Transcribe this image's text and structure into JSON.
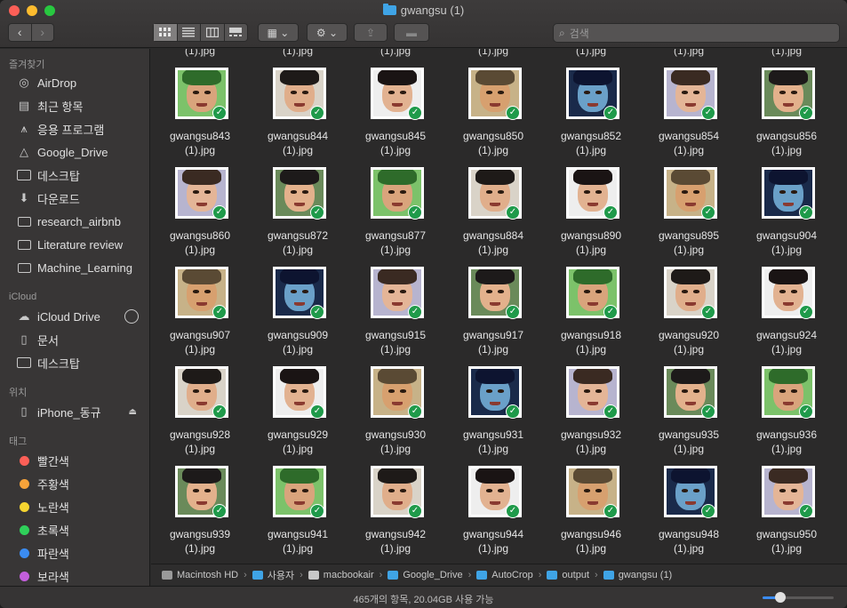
{
  "window": {
    "title": "gwangsu (1)"
  },
  "toolbar": {
    "back": "‹",
    "forward": "›",
    "view_icons": [
      "⊞",
      "≡",
      "⫼",
      "▭"
    ],
    "group_label": "▦ ⌄",
    "action_label": "⚙ ⌄",
    "share_label": "⇪",
    "tag_label": "▬"
  },
  "search": {
    "placeholder": "검색"
  },
  "sidebar": {
    "favorites_header": "즐겨찾기",
    "favorites": [
      {
        "label": "AirDrop",
        "icon": "airdrop-icon"
      },
      {
        "label": "최근 항목",
        "icon": "recents-icon"
      },
      {
        "label": "응용 프로그램",
        "icon": "applications-icon"
      },
      {
        "label": "Google_Drive",
        "icon": "drive-icon"
      },
      {
        "label": "데스크탑",
        "icon": "desktop-icon"
      },
      {
        "label": "다운로드",
        "icon": "downloads-icon"
      },
      {
        "label": "research_airbnb",
        "icon": "folder-icon"
      },
      {
        "label": "Literature review",
        "icon": "folder-icon"
      },
      {
        "label": "Machine_Learning",
        "icon": "folder-icon"
      }
    ],
    "icloud_header": "iCloud",
    "icloud": [
      {
        "label": "iCloud Drive",
        "icon": "cloud-icon"
      },
      {
        "label": "문서",
        "icon": "document-icon"
      },
      {
        "label": "데스크탑",
        "icon": "desktop-icon"
      }
    ],
    "locations_header": "위치",
    "locations": [
      {
        "label": "iPhone_동규",
        "icon": "iphone-icon"
      }
    ],
    "tags_header": "태그",
    "tags": [
      {
        "label": "빨간색",
        "color": "#fc5f57"
      },
      {
        "label": "주황색",
        "color": "#f7a33a"
      },
      {
        "label": "노란색",
        "color": "#f6d530"
      },
      {
        "label": "초록색",
        "color": "#2fd05a"
      },
      {
        "label": "파란색",
        "color": "#3b8cf2"
      },
      {
        "label": "보라색",
        "color": "#c35fdc"
      }
    ]
  },
  "top_partial_label": "(1).jpg",
  "files": [
    {
      "name": "gwangsu843",
      "ext": "(1).jpg"
    },
    {
      "name": "gwangsu844",
      "ext": "(1).jpg"
    },
    {
      "name": "gwangsu845",
      "ext": "(1).jpg"
    },
    {
      "name": "gwangsu850",
      "ext": "(1).jpg"
    },
    {
      "name": "gwangsu852",
      "ext": "(1).jpg"
    },
    {
      "name": "gwangsu854",
      "ext": "(1).jpg"
    },
    {
      "name": "gwangsu856",
      "ext": "(1).jpg"
    },
    {
      "name": "gwangsu860",
      "ext": "(1).jpg"
    },
    {
      "name": "gwangsu872",
      "ext": "(1).jpg"
    },
    {
      "name": "gwangsu877",
      "ext": "(1).jpg"
    },
    {
      "name": "gwangsu884",
      "ext": "(1).jpg"
    },
    {
      "name": "gwangsu890",
      "ext": "(1).jpg"
    },
    {
      "name": "gwangsu895",
      "ext": "(1).jpg"
    },
    {
      "name": "gwangsu904",
      "ext": "(1).jpg"
    },
    {
      "name": "gwangsu907",
      "ext": "(1).jpg"
    },
    {
      "name": "gwangsu909",
      "ext": "(1).jpg"
    },
    {
      "name": "gwangsu915",
      "ext": "(1).jpg"
    },
    {
      "name": "gwangsu917",
      "ext": "(1).jpg"
    },
    {
      "name": "gwangsu918",
      "ext": "(1).jpg"
    },
    {
      "name": "gwangsu920",
      "ext": "(1).jpg"
    },
    {
      "name": "gwangsu924",
      "ext": "(1).jpg"
    },
    {
      "name": "gwangsu928",
      "ext": "(1).jpg"
    },
    {
      "name": "gwangsu929",
      "ext": "(1).jpg"
    },
    {
      "name": "gwangsu930",
      "ext": "(1).jpg"
    },
    {
      "name": "gwangsu931",
      "ext": "(1).jpg"
    },
    {
      "name": "gwangsu932",
      "ext": "(1).jpg"
    },
    {
      "name": "gwangsu935",
      "ext": "(1).jpg"
    },
    {
      "name": "gwangsu936",
      "ext": "(1).jpg"
    },
    {
      "name": "gwangsu939",
      "ext": "(1).jpg"
    },
    {
      "name": "gwangsu941",
      "ext": "(1).jpg"
    },
    {
      "name": "gwangsu942",
      "ext": "(1).jpg"
    },
    {
      "name": "gwangsu944",
      "ext": "(1).jpg"
    },
    {
      "name": "gwangsu946",
      "ext": "(1).jpg"
    },
    {
      "name": "gwangsu948",
      "ext": "(1).jpg"
    },
    {
      "name": "gwangsu950",
      "ext": "(1).jpg"
    }
  ],
  "pathbar": [
    {
      "label": "Macintosh HD",
      "color": "#9a9a9a"
    },
    {
      "label": "사용자",
      "color": "#3fa4e6"
    },
    {
      "label": "macbookair",
      "color": "#c8c8c8"
    },
    {
      "label": "Google_Drive",
      "color": "#3fa4e6"
    },
    {
      "label": "AutoCrop",
      "color": "#3fa4e6"
    },
    {
      "label": "output",
      "color": "#3fa4e6"
    },
    {
      "label": "gwangsu (1)",
      "color": "#3fa4e6"
    }
  ],
  "statusbar": {
    "text": "465개의 항목, 20.04GB 사용 가능",
    "zoom_level": 0.25
  },
  "colors": {
    "accent": "#3b8cf2",
    "check": "#1f9a4a"
  }
}
